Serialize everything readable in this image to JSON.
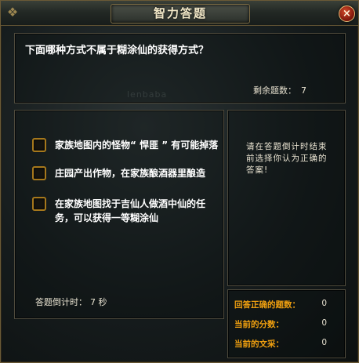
{
  "window": {
    "title": "智力答题",
    "close_icon": "×"
  },
  "question": {
    "text": "下面哪种方式不属于糊涂仙的获得方式？",
    "remaining_label": "剩余题数：",
    "remaining_value": "7",
    "watermark": "lenbaba"
  },
  "options": [
    {
      "label": "家族地图内的怪物“ 悍匪 ” 有可能掉落",
      "checked": false
    },
    {
      "label": "庄园产出作物，在家族酿酒器里酿造",
      "checked": false
    },
    {
      "label": "在家族地图找于吉仙人做酒中仙的任务，可以获得一等糊涂仙",
      "checked": false
    }
  ],
  "timer": {
    "label": "答题倒计时：",
    "value": "7 秒"
  },
  "hint": {
    "text": "请在答题倒计时结束前选择你认为正确的答案!"
  },
  "score": {
    "rows": [
      {
        "label": "回答正确的题数：",
        "value": "0"
      },
      {
        "label": "当前的分数：",
        "value": "0"
      },
      {
        "label": "当前的文采：",
        "value": "0"
      }
    ]
  },
  "colors": {
    "accent": "#f0a010",
    "checkbox_border": "#a6781c",
    "frame": "#6b5a36"
  }
}
